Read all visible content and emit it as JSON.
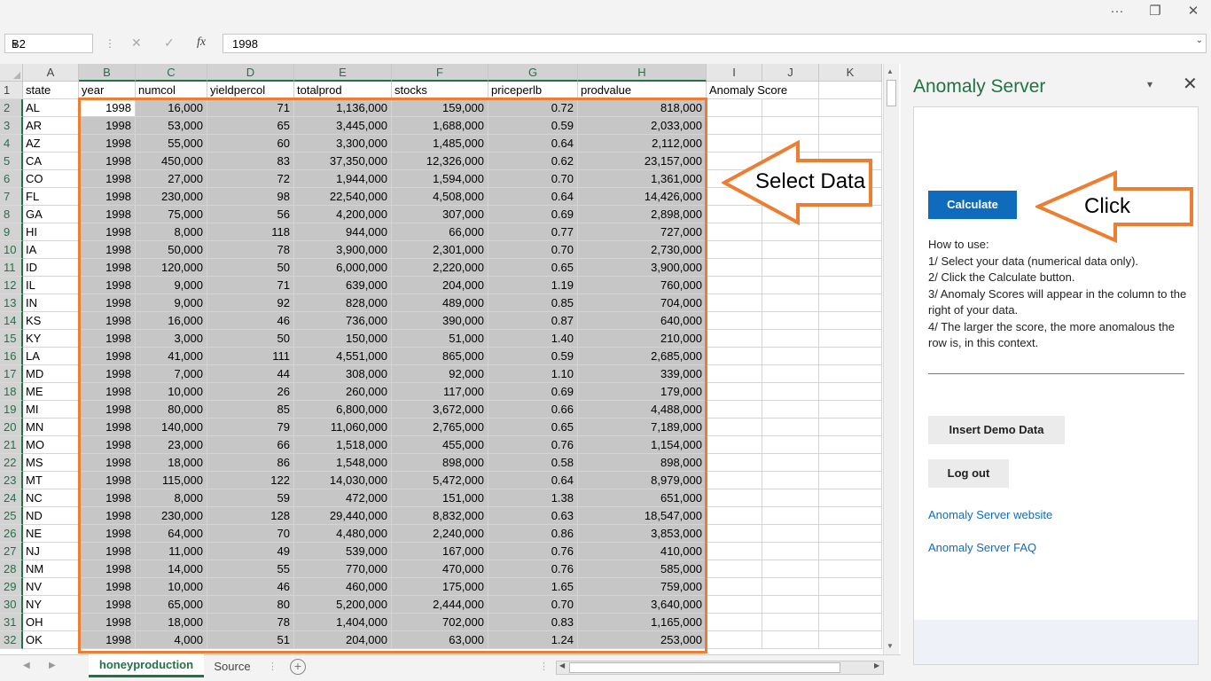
{
  "window": {
    "more_icon": "···",
    "restore_icon": "❐",
    "close_icon": "✕"
  },
  "formula_bar": {
    "name_box": "B2",
    "cancel_icon": "✕",
    "enter_icon": "✓",
    "fx_icon": "fx",
    "value": "1998"
  },
  "grid": {
    "columns": [
      "A",
      "B",
      "C",
      "D",
      "E",
      "F",
      "G",
      "H",
      "I",
      "J",
      "K"
    ],
    "headers": [
      "state",
      "year",
      "numcol",
      "yieldpercol",
      "totalprod",
      "stocks",
      "priceperlb",
      "prodvalue",
      "Anomaly Score"
    ],
    "rows": [
      [
        "AL",
        "1998",
        "16,000",
        "71",
        "1,136,000",
        "159,000",
        "0.72",
        "818,000"
      ],
      [
        "AR",
        "1998",
        "53,000",
        "65",
        "3,445,000",
        "1,688,000",
        "0.59",
        "2,033,000"
      ],
      [
        "AZ",
        "1998",
        "55,000",
        "60",
        "3,300,000",
        "1,485,000",
        "0.64",
        "2,112,000"
      ],
      [
        "CA",
        "1998",
        "450,000",
        "83",
        "37,350,000",
        "12,326,000",
        "0.62",
        "23,157,000"
      ],
      [
        "CO",
        "1998",
        "27,000",
        "72",
        "1,944,000",
        "1,594,000",
        "0.70",
        "1,361,000"
      ],
      [
        "FL",
        "1998",
        "230,000",
        "98",
        "22,540,000",
        "4,508,000",
        "0.64",
        "14,426,000"
      ],
      [
        "GA",
        "1998",
        "75,000",
        "56",
        "4,200,000",
        "307,000",
        "0.69",
        "2,898,000"
      ],
      [
        "HI",
        "1998",
        "8,000",
        "118",
        "944,000",
        "66,000",
        "0.77",
        "727,000"
      ],
      [
        "IA",
        "1998",
        "50,000",
        "78",
        "3,900,000",
        "2,301,000",
        "0.70",
        "2,730,000"
      ],
      [
        "ID",
        "1998",
        "120,000",
        "50",
        "6,000,000",
        "2,220,000",
        "0.65",
        "3,900,000"
      ],
      [
        "IL",
        "1998",
        "9,000",
        "71",
        "639,000",
        "204,000",
        "1.19",
        "760,000"
      ],
      [
        "IN",
        "1998",
        "9,000",
        "92",
        "828,000",
        "489,000",
        "0.85",
        "704,000"
      ],
      [
        "KS",
        "1998",
        "16,000",
        "46",
        "736,000",
        "390,000",
        "0.87",
        "640,000"
      ],
      [
        "KY",
        "1998",
        "3,000",
        "50",
        "150,000",
        "51,000",
        "1.40",
        "210,000"
      ],
      [
        "LA",
        "1998",
        "41,000",
        "111",
        "4,551,000",
        "865,000",
        "0.59",
        "2,685,000"
      ],
      [
        "MD",
        "1998",
        "7,000",
        "44",
        "308,000",
        "92,000",
        "1.10",
        "339,000"
      ],
      [
        "ME",
        "1998",
        "10,000",
        "26",
        "260,000",
        "117,000",
        "0.69",
        "179,000"
      ],
      [
        "MI",
        "1998",
        "80,000",
        "85",
        "6,800,000",
        "3,672,000",
        "0.66",
        "4,488,000"
      ],
      [
        "MN",
        "1998",
        "140,000",
        "79",
        "11,060,000",
        "2,765,000",
        "0.65",
        "7,189,000"
      ],
      [
        "MO",
        "1998",
        "23,000",
        "66",
        "1,518,000",
        "455,000",
        "0.76",
        "1,154,000"
      ],
      [
        "MS",
        "1998",
        "18,000",
        "86",
        "1,548,000",
        "898,000",
        "0.58",
        "898,000"
      ],
      [
        "MT",
        "1998",
        "115,000",
        "122",
        "14,030,000",
        "5,472,000",
        "0.64",
        "8,979,000"
      ],
      [
        "NC",
        "1998",
        "8,000",
        "59",
        "472,000",
        "151,000",
        "1.38",
        "651,000"
      ],
      [
        "ND",
        "1998",
        "230,000",
        "128",
        "29,440,000",
        "8,832,000",
        "0.63",
        "18,547,000"
      ],
      [
        "NE",
        "1998",
        "64,000",
        "70",
        "4,480,000",
        "2,240,000",
        "0.86",
        "3,853,000"
      ],
      [
        "NJ",
        "1998",
        "11,000",
        "49",
        "539,000",
        "167,000",
        "0.76",
        "410,000"
      ],
      [
        "NM",
        "1998",
        "14,000",
        "55",
        "770,000",
        "470,000",
        "0.76",
        "585,000"
      ],
      [
        "NV",
        "1998",
        "10,000",
        "46",
        "460,000",
        "175,000",
        "1.65",
        "759,000"
      ],
      [
        "NY",
        "1998",
        "65,000",
        "80",
        "5,200,000",
        "2,444,000",
        "0.70",
        "3,640,000"
      ],
      [
        "OH",
        "1998",
        "18,000",
        "78",
        "1,404,000",
        "702,000",
        "0.83",
        "1,165,000"
      ],
      [
        "OK",
        "1998",
        "4,000",
        "51",
        "204,000",
        "63,000",
        "1.24",
        "253,000"
      ]
    ]
  },
  "sheets": {
    "active": "honeyproduction",
    "other": "Source",
    "add_icon": "+"
  },
  "pane": {
    "title": "Anomaly Server",
    "dropdown_icon": "▾",
    "close_icon": "✕",
    "calculate_label": "Calculate",
    "howto_lines": [
      "How to use:",
      "1/ Select your data (numerical data only).",
      "2/ Click the Calculate button.",
      "3/ Anomaly Scores will appear in the column to the right of your data.",
      "4/ The larger the score, the more anomalous the row is, in this context."
    ],
    "demo_label": "Insert Demo Data",
    "logout_label": "Log out",
    "website_link": "Anomaly Server website",
    "faq_link": "Anomaly Server FAQ"
  },
  "annotations": {
    "select_text": "Select Data",
    "click_text": "Click",
    "accent_color": "#ed7d31"
  },
  "colors": {
    "excel_green": "#217346",
    "button_blue": "#0f6cbd"
  }
}
